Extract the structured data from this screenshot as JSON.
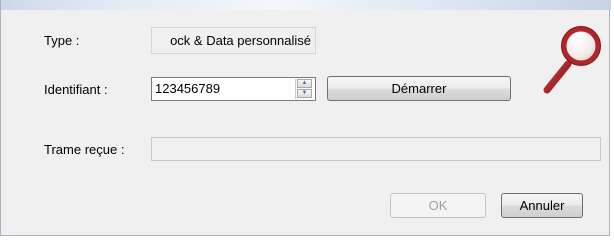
{
  "form": {
    "type_label": "Type :",
    "type_value": "ock & Data personnalisé",
    "id_label": "Identifiant :",
    "id_value": "123456789",
    "start_button": "Démarrer",
    "frame_label": "Trame reçue :",
    "frame_value": ""
  },
  "buttons": {
    "ok": "OK",
    "cancel": "Annuler"
  },
  "icons": {
    "magnifier": "magnifier-icon",
    "spinner_up": "spinner-up-icon",
    "spinner_down": "spinner-down-icon"
  },
  "colors": {
    "magnifier_accent": "#b1262a",
    "dialog_background": "#f0f0f0"
  }
}
